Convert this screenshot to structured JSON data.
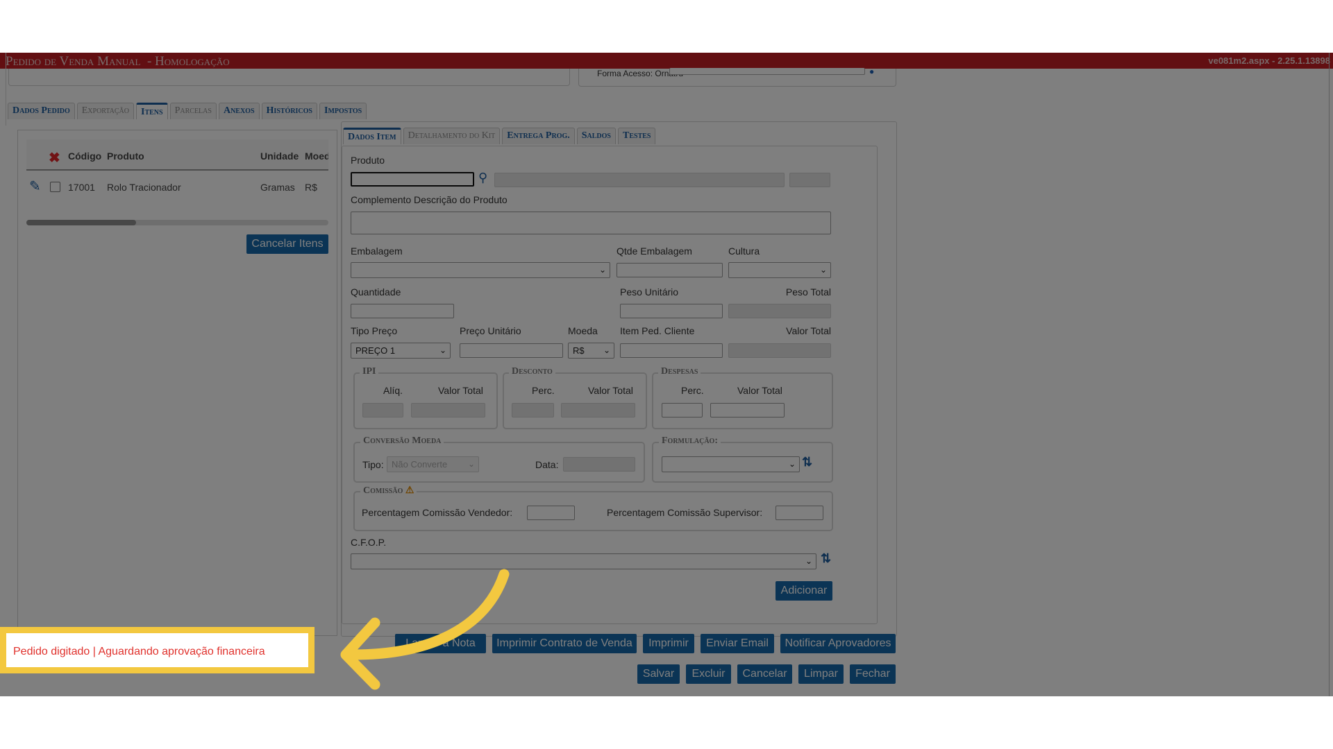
{
  "titlebar": {
    "title": "Pedido de Venda Manual  - Homologação",
    "version": "ve081m2.aspx - 2.25.1.13898"
  },
  "prev": {
    "field_label": "Forma Acesso: Ornatru"
  },
  "main_tabs": [
    "Dados Pedido",
    "Exportação",
    "Itens",
    "Parcelas",
    "Anexos",
    "Históricos",
    "Impostos"
  ],
  "main_tabs_state": [
    "normal",
    "dim",
    "active",
    "dim",
    "normal",
    "normal",
    "normal"
  ],
  "items_grid": {
    "headers": {
      "codigo": "Código",
      "produto": "Produto",
      "unidade": "Unidade",
      "moeda": "Moed"
    },
    "rows": [
      {
        "codigo": "17001",
        "produto": "Rolo Tracionador",
        "unidade": "Gramas",
        "moeda": "R$"
      }
    ],
    "cancel_button": "Cancelar Itens"
  },
  "item_tabs": [
    "Dados Item",
    "Detalhamento do Kit",
    "Entrega Prog.",
    "Saldos",
    "Testes"
  ],
  "item_tabs_state": [
    "active",
    "dim",
    "normal",
    "normal",
    "normal"
  ],
  "form": {
    "produto_label": "Produto",
    "complemento_label": "Complemento Descrição do Produto",
    "embalagem_label": "Embalagem",
    "qtde_embalagem_label": "Qtde Embalagem",
    "cultura_label": "Cultura",
    "quantidade_label": "Quantidade",
    "peso_unitario_label": "Peso Unitário",
    "peso_total_label": "Peso Total",
    "tipo_preco_label": "Tipo Preço",
    "tipo_preco_value": "PREÇO 1",
    "preco_unitario_label": "Preço Unitário",
    "moeda_label": "Moeda",
    "moeda_value": "R$",
    "item_ped_cliente_label": "Item Ped. Cliente",
    "valor_total_label": "Valor Total",
    "ipi": {
      "legend": "IPI",
      "aliq_label": "Alíq.",
      "valor_total_label": "Valor Total"
    },
    "desconto": {
      "legend": "Desconto",
      "perc_label": "Perc.",
      "valor_total_label": "Valor Total"
    },
    "despesas": {
      "legend": "Despesas",
      "perc_label": "Perc.",
      "valor_total_label": "Valor Total"
    },
    "conversao": {
      "legend": "Conversão Moeda",
      "tipo_label": "Tipo:",
      "tipo_value": "Não Converte",
      "data_label": "Data:"
    },
    "formulacao": {
      "legend": "Formulação:"
    },
    "comissao": {
      "legend": "Comissão",
      "vendedor_label": "Percentagem Comissão Vendedor:",
      "supervisor_label": "Percentagem Comissão Supervisor:"
    },
    "cfop_label": "C.F.O.P.",
    "adicionar_button": "Adicionar"
  },
  "bottom_buttons_row1": [
    "Lançar a Nota",
    "Imprimir Contrato de Venda",
    "Imprimir",
    "Enviar Email",
    "Notificar Aprovadores"
  ],
  "bottom_buttons_row2": [
    "Salvar",
    "Excluir",
    "Cancelar",
    "Limpar",
    "Fechar"
  ],
  "status": {
    "text": "Pedido digitado | Aguardando aprovação financeira"
  },
  "colors": {
    "titlebar": "#c41e24",
    "button": "#1769aa",
    "highlight": "#f3c840",
    "status_text": "#e0312c",
    "tab_text": "#1d5c9e"
  }
}
